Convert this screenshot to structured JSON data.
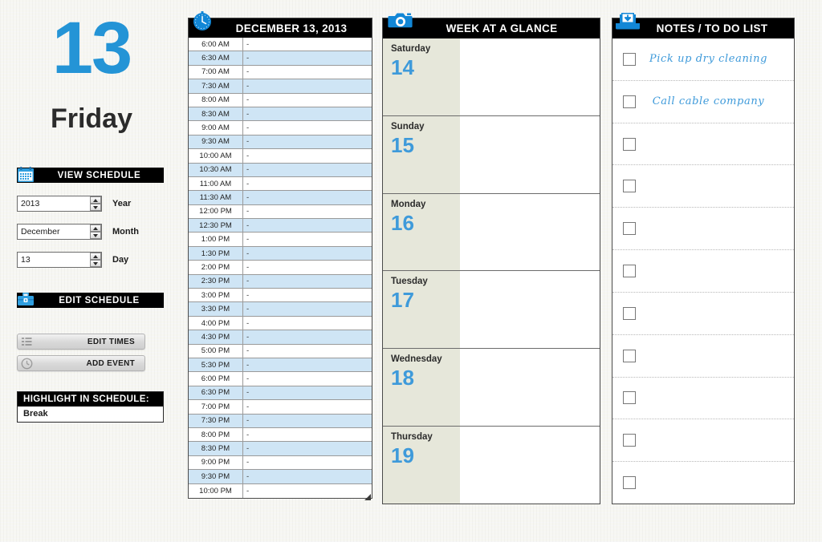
{
  "left": {
    "day_number": "13",
    "weekday": "Friday",
    "view_schedule": {
      "title": "VIEW SCHEDULE",
      "icon": "calendar-icon"
    },
    "edit_schedule": {
      "title": "EDIT SCHEDULE",
      "icon": "toolbox-icon"
    },
    "fields": [
      {
        "name": "year",
        "value": "2013",
        "label": "Year"
      },
      {
        "name": "month",
        "value": "December",
        "label": "Month"
      },
      {
        "name": "day",
        "value": "13",
        "label": "Day"
      }
    ],
    "buttons": [
      {
        "name": "edit-times",
        "label": "EDIT TIMES",
        "icon": "list-icon"
      },
      {
        "name": "add-event",
        "label": "ADD EVENT",
        "icon": "clock-icon"
      }
    ],
    "highlight": {
      "title": "HIGHLIGHT IN SCHEDULE:",
      "value": "Break"
    }
  },
  "schedule": {
    "icon": "clock-icon",
    "title": "DECEMBER 13, 2013",
    "rows": [
      {
        "time": "6:00 AM",
        "value": "-"
      },
      {
        "time": "6:30 AM",
        "value": "-"
      },
      {
        "time": "7:00 AM",
        "value": "-"
      },
      {
        "time": "7:30 AM",
        "value": "-"
      },
      {
        "time": "8:00 AM",
        "value": "-"
      },
      {
        "time": "8:30 AM",
        "value": "-"
      },
      {
        "time": "9:00 AM",
        "value": "-"
      },
      {
        "time": "9:30 AM",
        "value": "-"
      },
      {
        "time": "10:00 AM",
        "value": "-"
      },
      {
        "time": "10:30 AM",
        "value": "-"
      },
      {
        "time": "11:00 AM",
        "value": "-"
      },
      {
        "time": "11:30 AM",
        "value": "-"
      },
      {
        "time": "12:00 PM",
        "value": "-"
      },
      {
        "time": "12:30 PM",
        "value": "-"
      },
      {
        "time": "1:00 PM",
        "value": "-"
      },
      {
        "time": "1:30 PM",
        "value": "-"
      },
      {
        "time": "2:00 PM",
        "value": "-"
      },
      {
        "time": "2:30 PM",
        "value": "-"
      },
      {
        "time": "3:00 PM",
        "value": "-"
      },
      {
        "time": "3:30 PM",
        "value": "-"
      },
      {
        "time": "4:00 PM",
        "value": "-"
      },
      {
        "time": "4:30 PM",
        "value": "-"
      },
      {
        "time": "5:00 PM",
        "value": "-"
      },
      {
        "time": "5:30 PM",
        "value": "-"
      },
      {
        "time": "6:00 PM",
        "value": "-"
      },
      {
        "time": "6:30 PM",
        "value": "-"
      },
      {
        "time": "7:00 PM",
        "value": "-"
      },
      {
        "time": "7:30 PM",
        "value": "-"
      },
      {
        "time": "8:00 PM",
        "value": "-"
      },
      {
        "time": "8:30 PM",
        "value": "-"
      },
      {
        "time": "9:00 PM",
        "value": "-"
      },
      {
        "time": "9:30 PM",
        "value": "-"
      },
      {
        "time": "10:00 PM",
        "value": "-"
      }
    ]
  },
  "week": {
    "icon": "camera-icon",
    "title": "WEEK AT A GLANCE",
    "days": [
      {
        "name": "Saturday",
        "number": "14",
        "notes": ""
      },
      {
        "name": "Sunday",
        "number": "15",
        "notes": ""
      },
      {
        "name": "Monday",
        "number": "16",
        "notes": ""
      },
      {
        "name": "Tuesday",
        "number": "17",
        "notes": ""
      },
      {
        "name": "Wednesday",
        "number": "18",
        "notes": ""
      },
      {
        "name": "Thursday",
        "number": "19",
        "notes": ""
      }
    ]
  },
  "notes": {
    "icon": "inbox-download-icon",
    "title": "NOTES / TO DO LIST",
    "items": [
      {
        "checked": false,
        "text": "Pick up dry cleaning"
      },
      {
        "checked": false,
        "text": "Call cable company"
      },
      {
        "checked": false,
        "text": ""
      },
      {
        "checked": false,
        "text": ""
      },
      {
        "checked": false,
        "text": ""
      },
      {
        "checked": false,
        "text": ""
      },
      {
        "checked": false,
        "text": ""
      },
      {
        "checked": false,
        "text": ""
      },
      {
        "checked": false,
        "text": ""
      },
      {
        "checked": false,
        "text": ""
      },
      {
        "checked": false,
        "text": ""
      }
    ]
  },
  "colors": {
    "accent_blue": "#2494d6",
    "day_number_blue": "#3e9ada",
    "row_alt_blue": "#cfe5f5",
    "week_daycell": "#e6e7da",
    "bar_black": "#000000",
    "page_bg": "#f7f7f2"
  }
}
